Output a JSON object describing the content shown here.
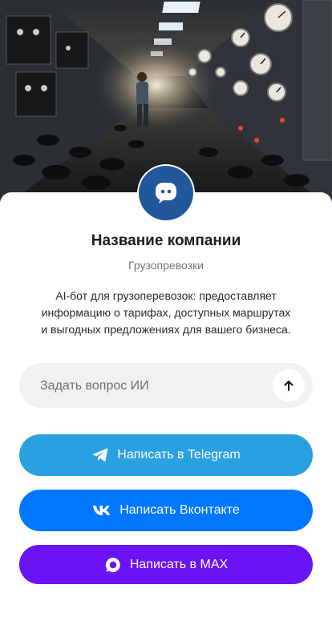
{
  "hero": {
    "image": "industrial control room with engineer"
  },
  "company": {
    "name": "Название компании",
    "category": "Грузопревозки",
    "description": "AI-бот для грузоперевозок: предоставляет информацию о тарифах, доступных маршрутах и выгодных предложениях для вашего бизнеса.",
    "avatar_icon": "chat-bot-icon"
  },
  "ask": {
    "placeholder": "Задать вопрос ИИ",
    "value": "",
    "send_icon": "arrow-up-icon"
  },
  "buttons": [
    {
      "label": "Написать в Telegram",
      "icon": "telegram-icon",
      "color": "#2aa0e0"
    },
    {
      "label": "Написать Вконтакте",
      "icon": "vk-icon",
      "color": "#0077ff"
    },
    {
      "label": "Написать в MAX",
      "icon": "max-icon",
      "color": "#6a13f5"
    }
  ],
  "colors": {
    "avatar": "#22589a",
    "input_bg": "#f1f1f2"
  }
}
